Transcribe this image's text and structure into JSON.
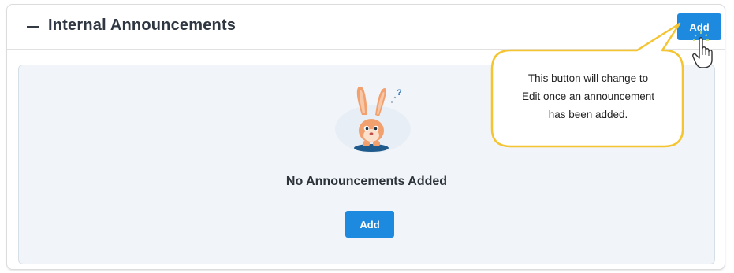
{
  "panel": {
    "title": "Internal Announcements",
    "collapse_icon": "minus-icon",
    "header_add_label": "Add"
  },
  "empty_state": {
    "illustration": "bunny-mascot-icon",
    "message": "No Announcements Added",
    "add_label": "Add"
  },
  "callout": {
    "text_line1": "This button will change to",
    "text_line2": "Edit once an announcement",
    "text_line3": "has been added."
  },
  "colors": {
    "accent": "#1d8ae0",
    "callout_border": "#f5c431",
    "mascot_orange": "#f2a06e"
  }
}
